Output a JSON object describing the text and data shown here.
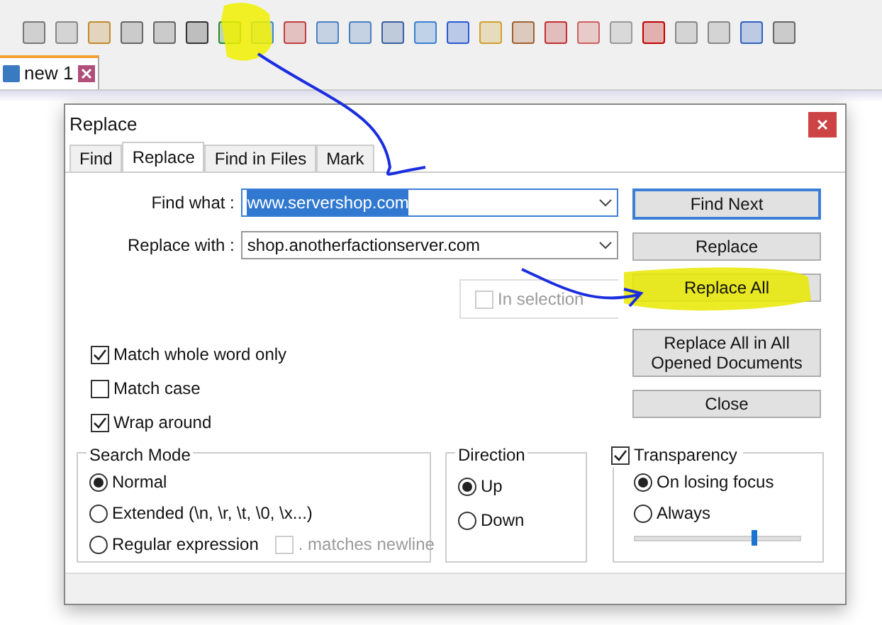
{
  "file_tab": {
    "label": "new 1"
  },
  "dialog": {
    "title": "Replace",
    "tabs": [
      {
        "label": "Find",
        "selected": false
      },
      {
        "label": "Replace",
        "selected": true
      },
      {
        "label": "Find in Files",
        "selected": false
      },
      {
        "label": "Mark",
        "selected": false
      }
    ],
    "fields": [
      {
        "label": "Find what :",
        "value": "www.servershop.com",
        "focused": true
      },
      {
        "label": "Replace with :",
        "value": "shop.anotherfactionserver.com",
        "focused": false
      }
    ],
    "buttons": [
      {
        "label": "Find Next",
        "default": true
      },
      {
        "label": "Replace",
        "default": false
      },
      {
        "label": "Replace All",
        "default": false
      },
      {
        "label": "Replace All in All Opened Documents",
        "default": false
      },
      {
        "label": "Close",
        "default": false
      }
    ],
    "in_selection": {
      "label": "In selection",
      "checked": false,
      "disabled": true
    },
    "options": [
      {
        "label": "Match whole word only",
        "checked": true
      },
      {
        "label": "Match case",
        "checked": false
      },
      {
        "label": "Wrap around",
        "checked": true
      }
    ],
    "search_mode": {
      "title": "Search Mode",
      "options": [
        {
          "label": "Normal",
          "selected": true
        },
        {
          "label": "Extended (\\n, \\r, \\t, \\0, \\x...)",
          "selected": false
        },
        {
          "label": "Regular expression",
          "selected": false
        }
      ],
      "dot_newline": {
        "label": ". matches newline",
        "checked": false,
        "disabled": true
      }
    },
    "direction": {
      "title": "Direction",
      "options": [
        {
          "label": "Up",
          "selected": true
        },
        {
          "label": "Down",
          "selected": false
        }
      ]
    },
    "transparency": {
      "label": "Transparency",
      "checked": true,
      "options": [
        {
          "label": "On losing focus",
          "selected": true
        },
        {
          "label": "Always",
          "selected": false
        }
      ],
      "level": 0.72
    }
  }
}
